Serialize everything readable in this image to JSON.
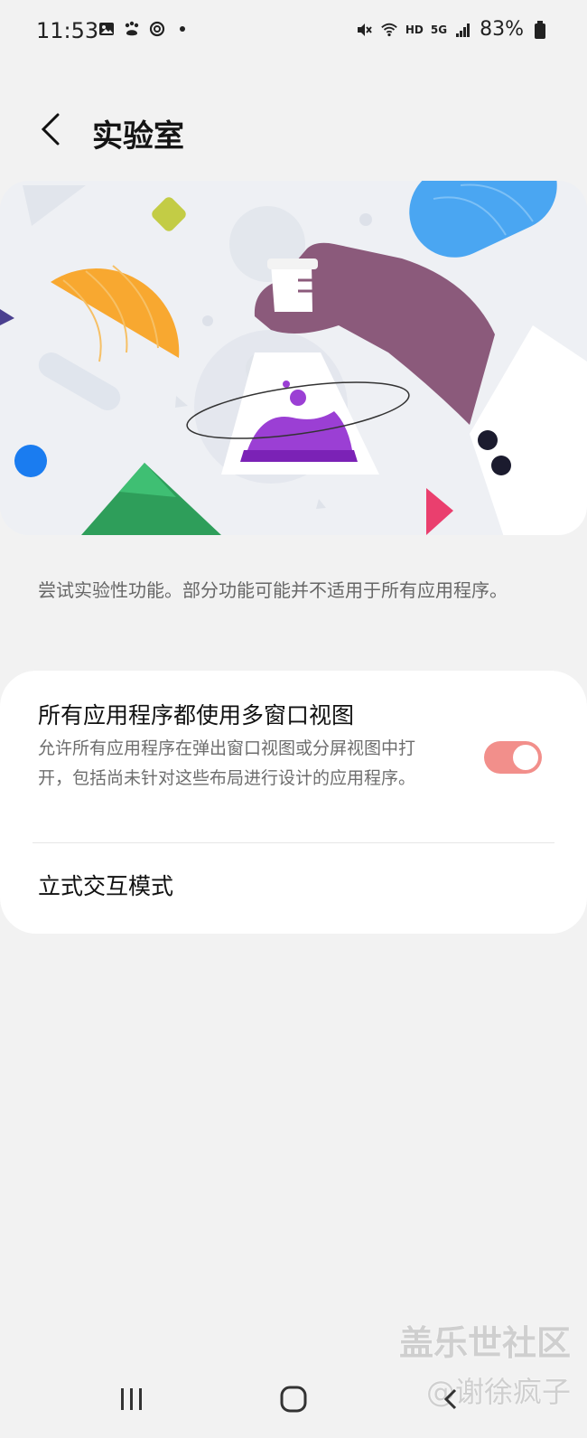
{
  "status_bar": {
    "time": "11:53",
    "network_label": "HD",
    "network_type": "5G",
    "battery_percent": "83%",
    "icons": [
      "gallery-icon",
      "baidu-paw-icon",
      "sync-icon",
      "dot-icon",
      "mute-icon",
      "wifi-icon",
      "signal-icon",
      "battery-icon"
    ]
  },
  "header": {
    "title": "实验室",
    "back_icon": "chevron-left-icon"
  },
  "description": "尝试实验性功能。部分功能可能并不适用于所有应用程序。",
  "settings": [
    {
      "title": "所有应用程序都使用多窗口视图",
      "subtitle": "允许所有应用程序在弹出窗口视图或分屏视图中打开，包括尚未针对这些布局进行设计的应用程序。",
      "toggle_on": true
    },
    {
      "title": "立式交互模式"
    }
  ],
  "watermark": {
    "line1": "盖乐世社区",
    "line2": "@谢徐疯子"
  },
  "colors": {
    "background": "#f2f2f2",
    "toggle_on": "#f28f8b",
    "card": "#ffffff"
  },
  "navigation": {
    "buttons": [
      "recents-icon",
      "home-icon",
      "back-icon"
    ]
  }
}
